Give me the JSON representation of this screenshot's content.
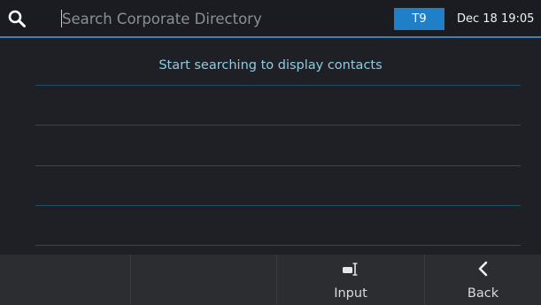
{
  "header": {
    "search_placeholder": "Search Corporate Directory",
    "search_value": "",
    "input_mode": "T9",
    "datetime": "Dec 18 19:05"
  },
  "content": {
    "status_message": "Start searching to display contacts",
    "empty_rows": 5
  },
  "softkeys": [
    {
      "label": "",
      "icon": ""
    },
    {
      "label": "",
      "icon": ""
    },
    {
      "label": "Input",
      "icon": "input-mode-icon"
    },
    {
      "label": "Back",
      "icon": "chevron-left-icon"
    }
  ],
  "colors": {
    "accent": "#1f7fc7",
    "header_underline": "#3d82b5",
    "status_text": "#8fcbe2",
    "divider": "#1f4f64",
    "softkey_bar": "#2b2d30"
  }
}
